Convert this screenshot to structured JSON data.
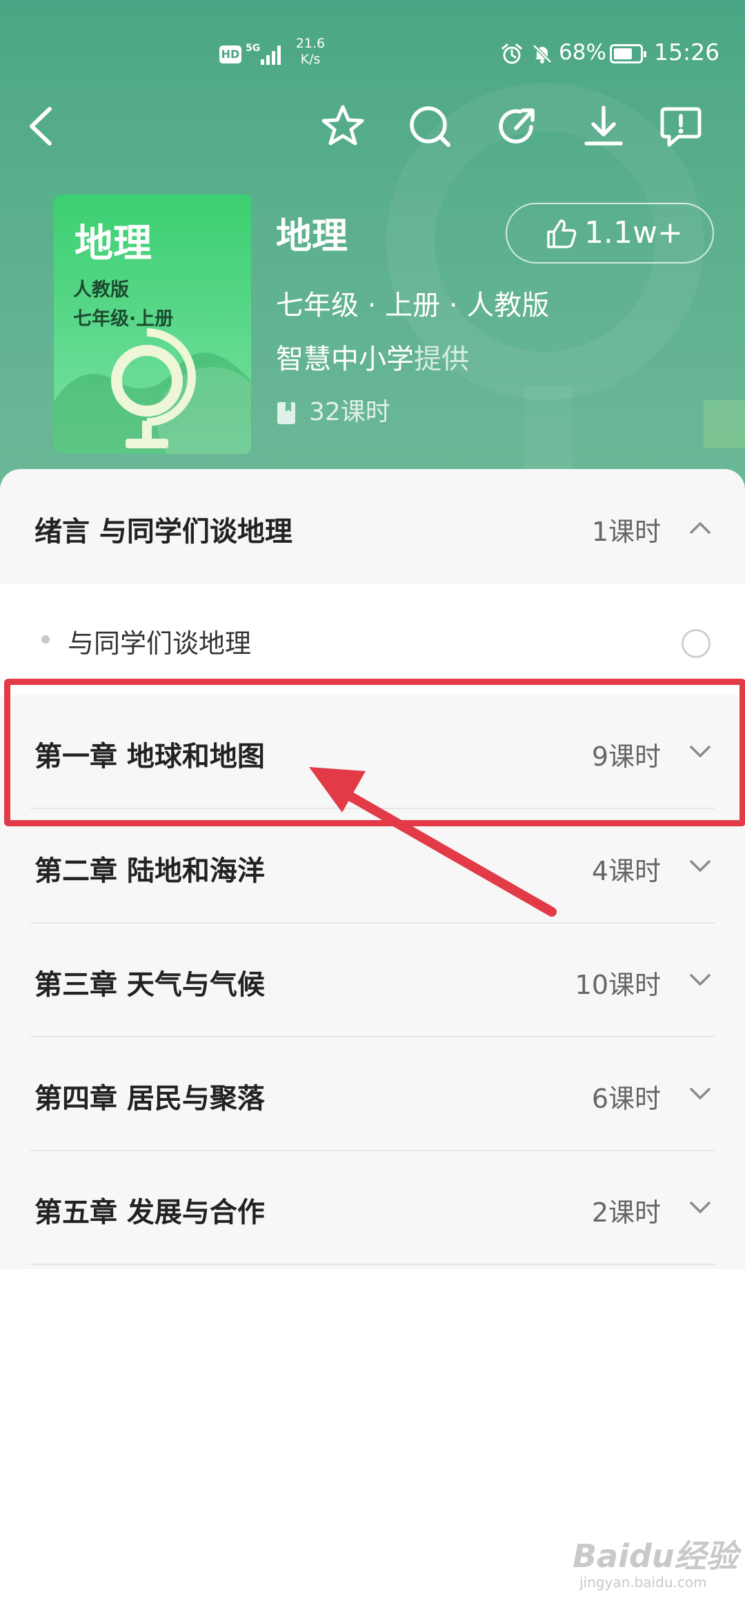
{
  "status_bar": {
    "hd": "HD",
    "network": "5G",
    "speed_value": "21.6",
    "speed_unit": "K/s",
    "battery": "68%",
    "time": "15:26"
  },
  "toolbar": {
    "icons": [
      "back-icon",
      "star-icon",
      "search-icon",
      "share-icon",
      "download-icon",
      "feedback-icon"
    ]
  },
  "book": {
    "cover_title": "地理",
    "cover_line1": "人教版",
    "cover_line2": "七年级·上册",
    "title": "地理",
    "likes": "1.1w+",
    "meta": "七年级 · 上册 · 人教版",
    "provider_name": "智慧中小学",
    "provider_suffix": "提供",
    "lessons": "32课时"
  },
  "intro": {
    "title": "绪言  与同学们谈地理",
    "hours": "1课时",
    "sub_items": [
      "与同学们谈地理"
    ]
  },
  "chapters": [
    {
      "title": "第一章 地球和地图",
      "hours": "9课时"
    },
    {
      "title": "第二章 陆地和海洋",
      "hours": "4课时"
    },
    {
      "title": "第三章 天气与气候",
      "hours": "10课时"
    },
    {
      "title": "第四章 居民与聚落",
      "hours": "6课时"
    },
    {
      "title": "第五章 发展与合作",
      "hours": "2课时"
    }
  ],
  "colors": {
    "header_green": "#4aa684",
    "highlight_red": "#e23a47",
    "cover_green": "#3ccf70"
  },
  "watermark": {
    "brand": "Baidu经验",
    "site": "jingyan.baidu.com"
  }
}
